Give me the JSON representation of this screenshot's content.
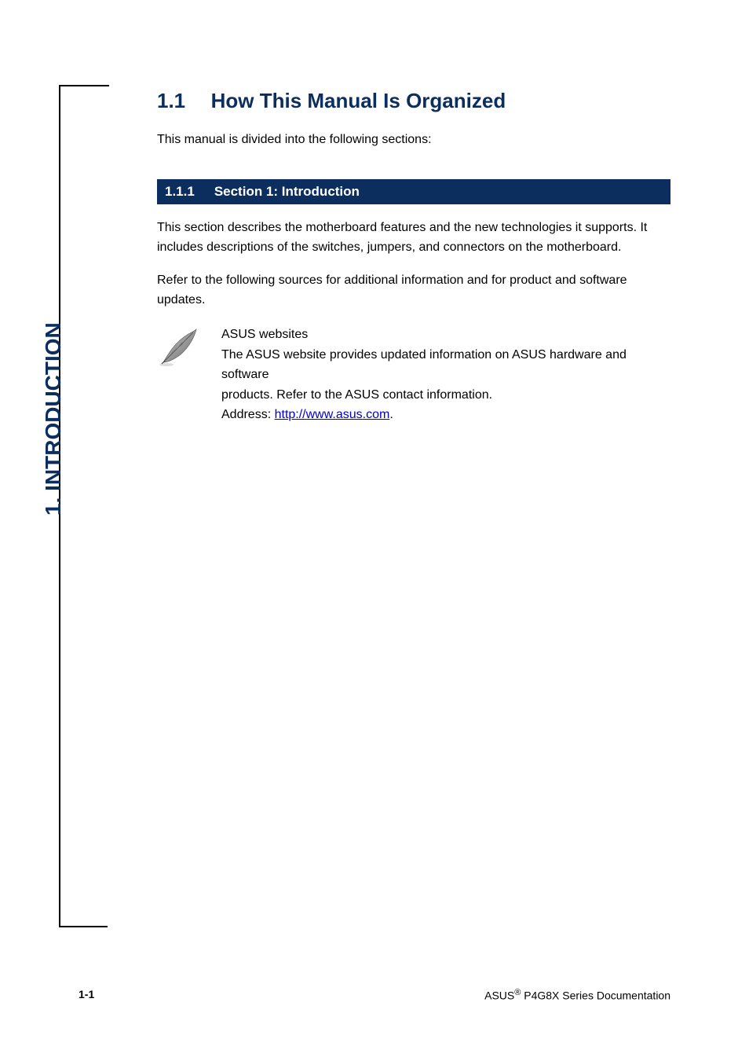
{
  "sidebarLabel": "1. INTRODUCTION",
  "section": {
    "number": "1.1",
    "title": "How This Manual Is Organized"
  },
  "intro": "This manual is divided into the following sections:",
  "subsection": {
    "number": "1.1.1",
    "title": "Section 1: Introduction"
  },
  "para1": "This section describes the motherboard features and the new technologies it supports. It includes descriptions of the switches, jumpers, and connectors on the motherboard.",
  "para2": "Refer to the following sources for additional information and for product and software updates.",
  "noteLines": [
    "ASUS websites",
    "The ASUS website provides updated information on ASUS hardware and software",
    "products. Refer to the ASUS contact information.",
    "Address: ",
    "."
  ],
  "noteLink": "http://www.asus.com",
  "footer": {
    "left": "1-1",
    "rightPrefix": "ASUS",
    "rightSuffix": " P4G8X Series Documentation"
  }
}
